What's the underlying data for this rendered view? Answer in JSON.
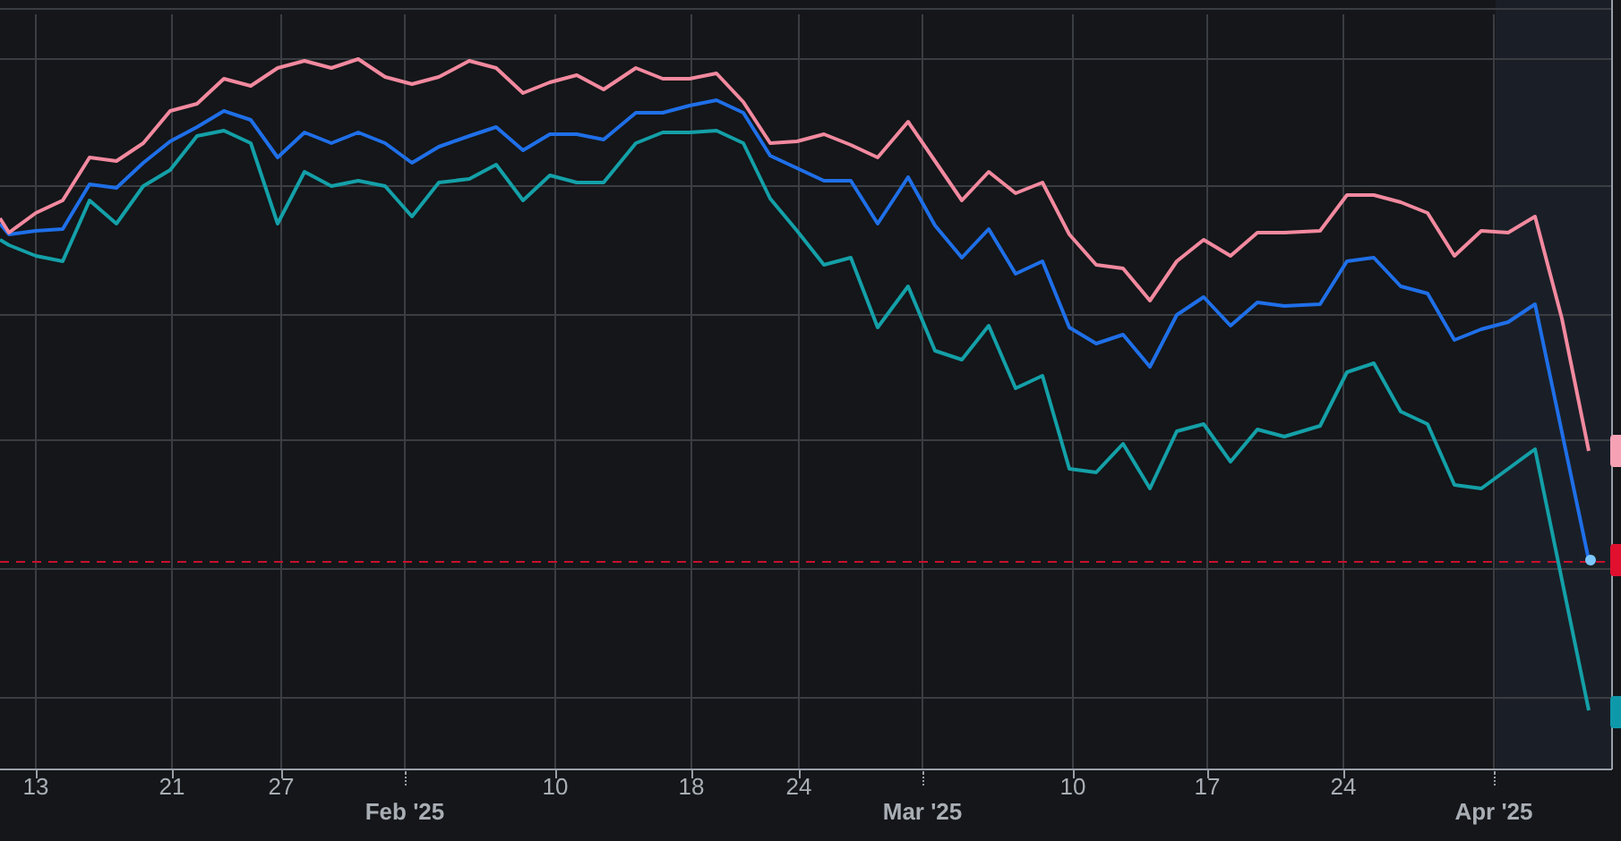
{
  "x_axis": {
    "day_ticks": [
      "13",
      "21",
      "27",
      "10",
      "18",
      "24",
      "10",
      "17",
      "24"
    ],
    "month_ticks": [
      "Feb '25",
      "Mar '25",
      "Apr '25"
    ]
  }
}
